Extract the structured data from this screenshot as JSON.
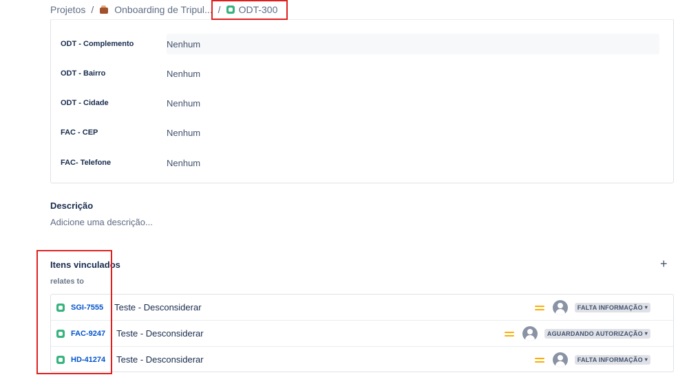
{
  "breadcrumb": {
    "projects": "Projetos",
    "separator": "/",
    "project": "Onboarding de Tripul...",
    "issue_key": "ODT-300"
  },
  "fields": [
    {
      "label": "ODT - Complemento",
      "value": "Nenhum"
    },
    {
      "label": "ODT - Bairro",
      "value": "Nenhum"
    },
    {
      "label": "ODT - Cidade",
      "value": "Nenhum"
    },
    {
      "label": "FAC - CEP",
      "value": "Nenhum"
    },
    {
      "label": "FAC- Telefone",
      "value": "Nenhum"
    }
  ],
  "description": {
    "title": "Descrição",
    "placeholder": "Adicione uma descrição..."
  },
  "linked": {
    "title": "Itens vinculados",
    "add": "+",
    "relation": "relates to",
    "items": [
      {
        "key": "SGI-7555",
        "summary": "Teste - Desconsiderar",
        "status": "FALTA INFORMAÇÃO"
      },
      {
        "key": "FAC-9247",
        "summary": "Teste - Desconsiderar",
        "status": "AGUARDANDO AUTORIZAÇÃO"
      },
      {
        "key": "HD-41274",
        "summary": "Teste - Desconsiderar",
        "status": "FALTA INFORMAÇÃO"
      }
    ]
  },
  "icons": {
    "issue_type": "story-icon",
    "priority": "priority-medium-icon",
    "assignee": "unassigned-avatar-icon",
    "status_dropdown": "chevron-down-icon"
  },
  "colors": {
    "highlight": "#e01e1e",
    "link": "#0052cc",
    "issue_icon": "#36b37e",
    "priority_medium": "#ffab00"
  }
}
